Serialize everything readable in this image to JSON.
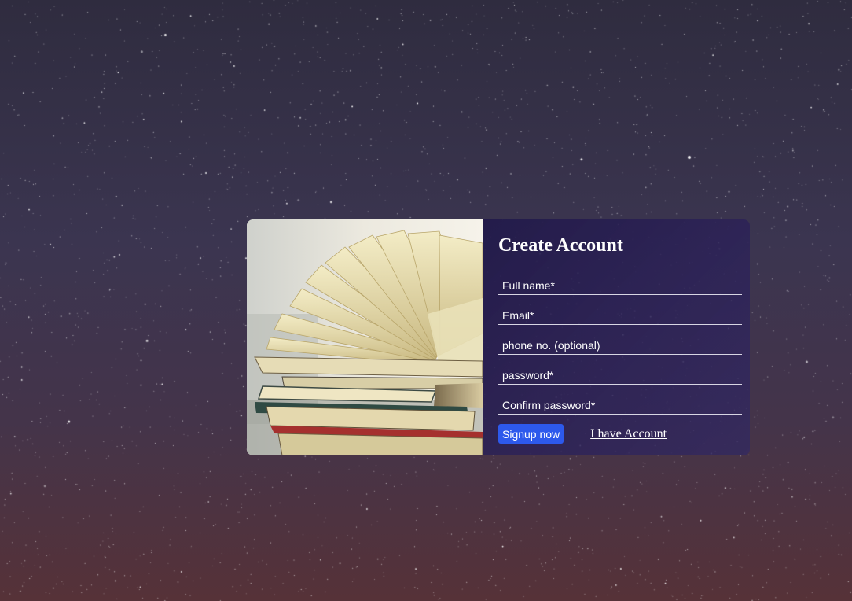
{
  "form": {
    "title": "Create Account",
    "fields": [
      {
        "placeholder": "Full name*",
        "value": ""
      },
      {
        "placeholder": "Email*",
        "value": ""
      },
      {
        "placeholder": "phone no. (optional)",
        "value": ""
      },
      {
        "placeholder": "password*",
        "value": ""
      },
      {
        "placeholder": "Confirm password*",
        "value": ""
      }
    ],
    "signup_label": "Signup now",
    "login_link": "I have Account"
  },
  "colors": {
    "button": "#2d59ec",
    "panel": "#221a4a",
    "sky_top": "#2f2c3f",
    "sky_bottom": "#563238"
  },
  "images": {
    "background": "starry night sky",
    "card": "stack of open books"
  }
}
